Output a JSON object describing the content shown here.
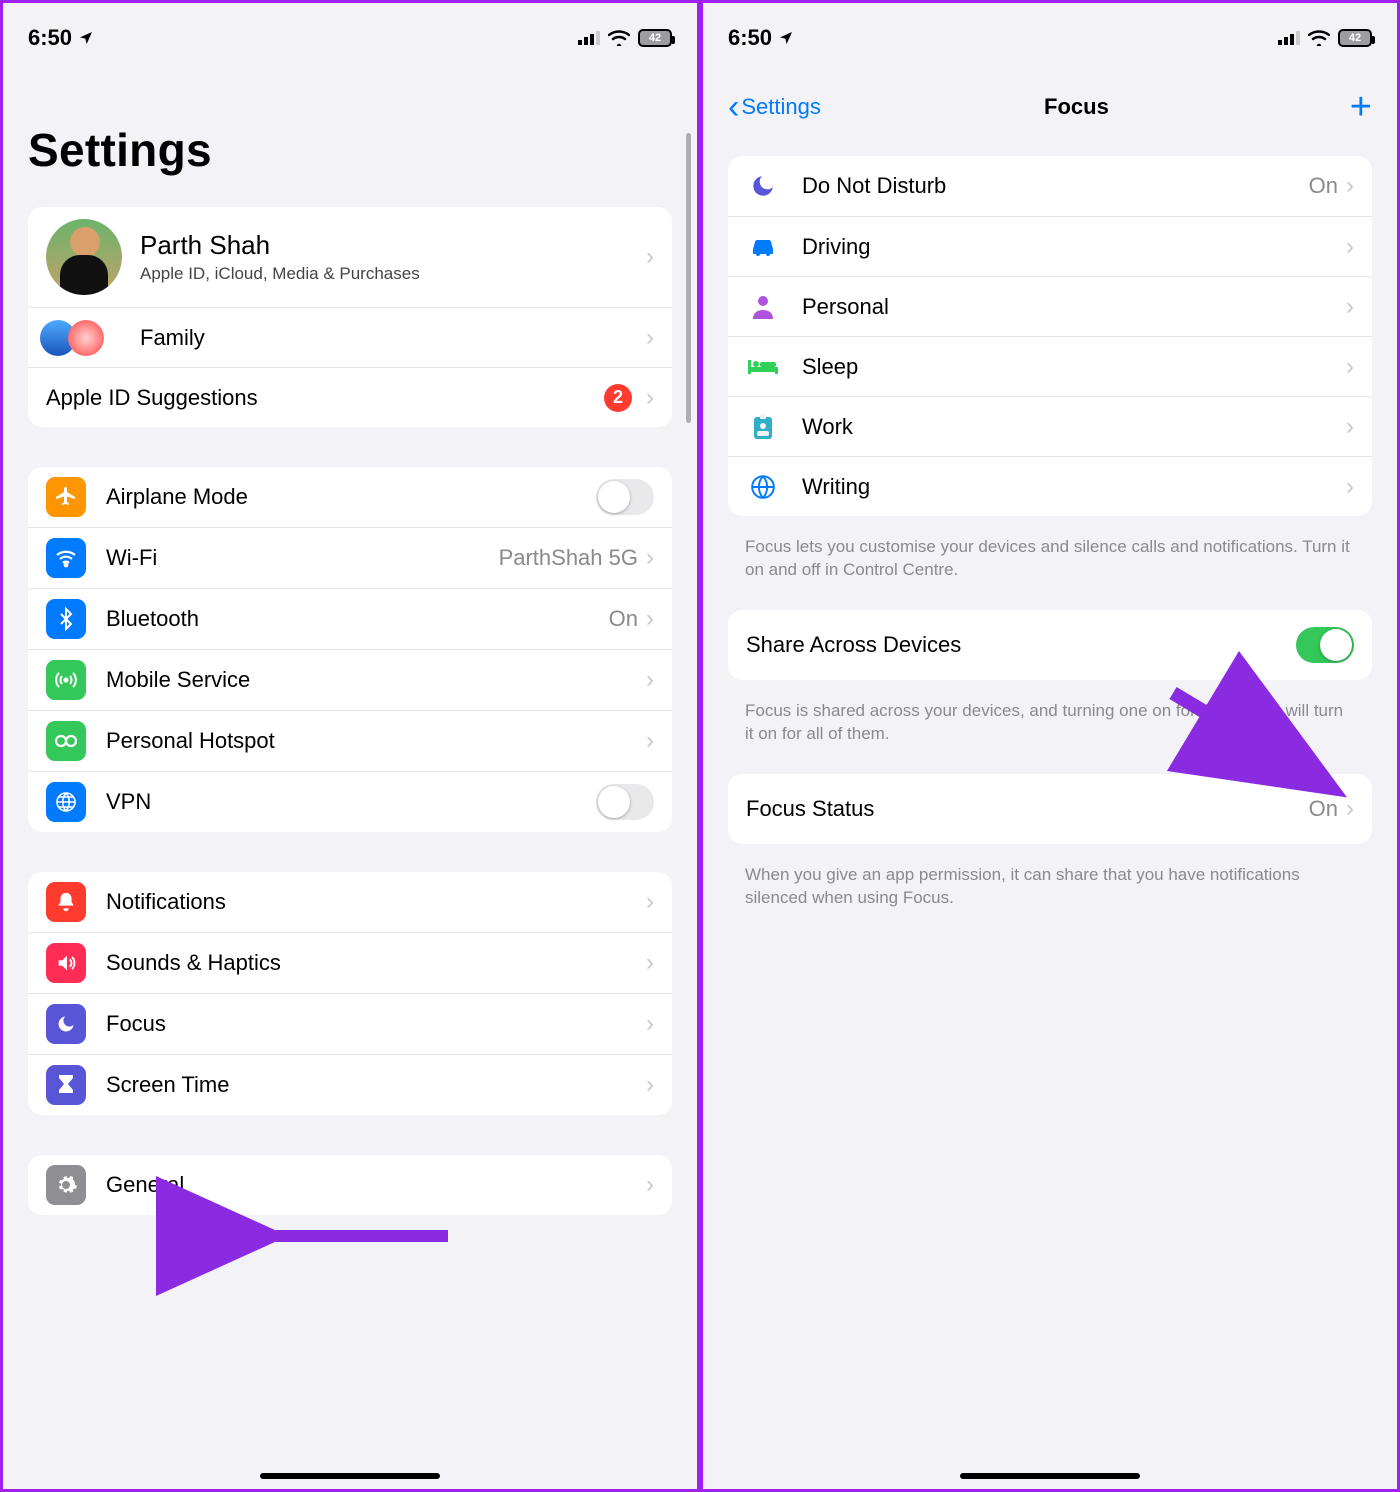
{
  "status": {
    "time": "6:50",
    "battery": "42"
  },
  "left": {
    "title": "Settings",
    "profile": {
      "name": "Parth Shah",
      "desc": "Apple ID, iCloud, Media & Purchases"
    },
    "family_label": "Family",
    "suggestions": {
      "label": "Apple ID Suggestions",
      "count": "2"
    },
    "net": {
      "airplane": "Airplane Mode",
      "wifi": {
        "label": "Wi-Fi",
        "value": "ParthShah 5G"
      },
      "bluetooth": {
        "label": "Bluetooth",
        "value": "On"
      },
      "mobile": "Mobile Service",
      "hotspot": "Personal Hotspot",
      "vpn": "VPN"
    },
    "sys": {
      "notifications": "Notifications",
      "sounds": "Sounds & Haptics",
      "focus": "Focus",
      "screentime": "Screen Time"
    },
    "general": "General"
  },
  "right": {
    "back": "Settings",
    "title": "Focus",
    "modes": {
      "dnd": {
        "label": "Do Not Disturb",
        "value": "On"
      },
      "driving": {
        "label": "Driving"
      },
      "personal": {
        "label": "Personal"
      },
      "sleep": {
        "label": "Sleep"
      },
      "work": {
        "label": "Work"
      },
      "writing": {
        "label": "Writing"
      }
    },
    "note1": "Focus lets you customise your devices and silence calls and notifications. Turn it on and off in Control Centre.",
    "share_label": "Share Across Devices",
    "note2": "Focus is shared across your devices, and turning one on for this device will turn it on for all of them.",
    "status": {
      "label": "Focus Status",
      "value": "On"
    },
    "note3": "When you give an app permission, it can share that you have notifications silenced when using Focus."
  }
}
